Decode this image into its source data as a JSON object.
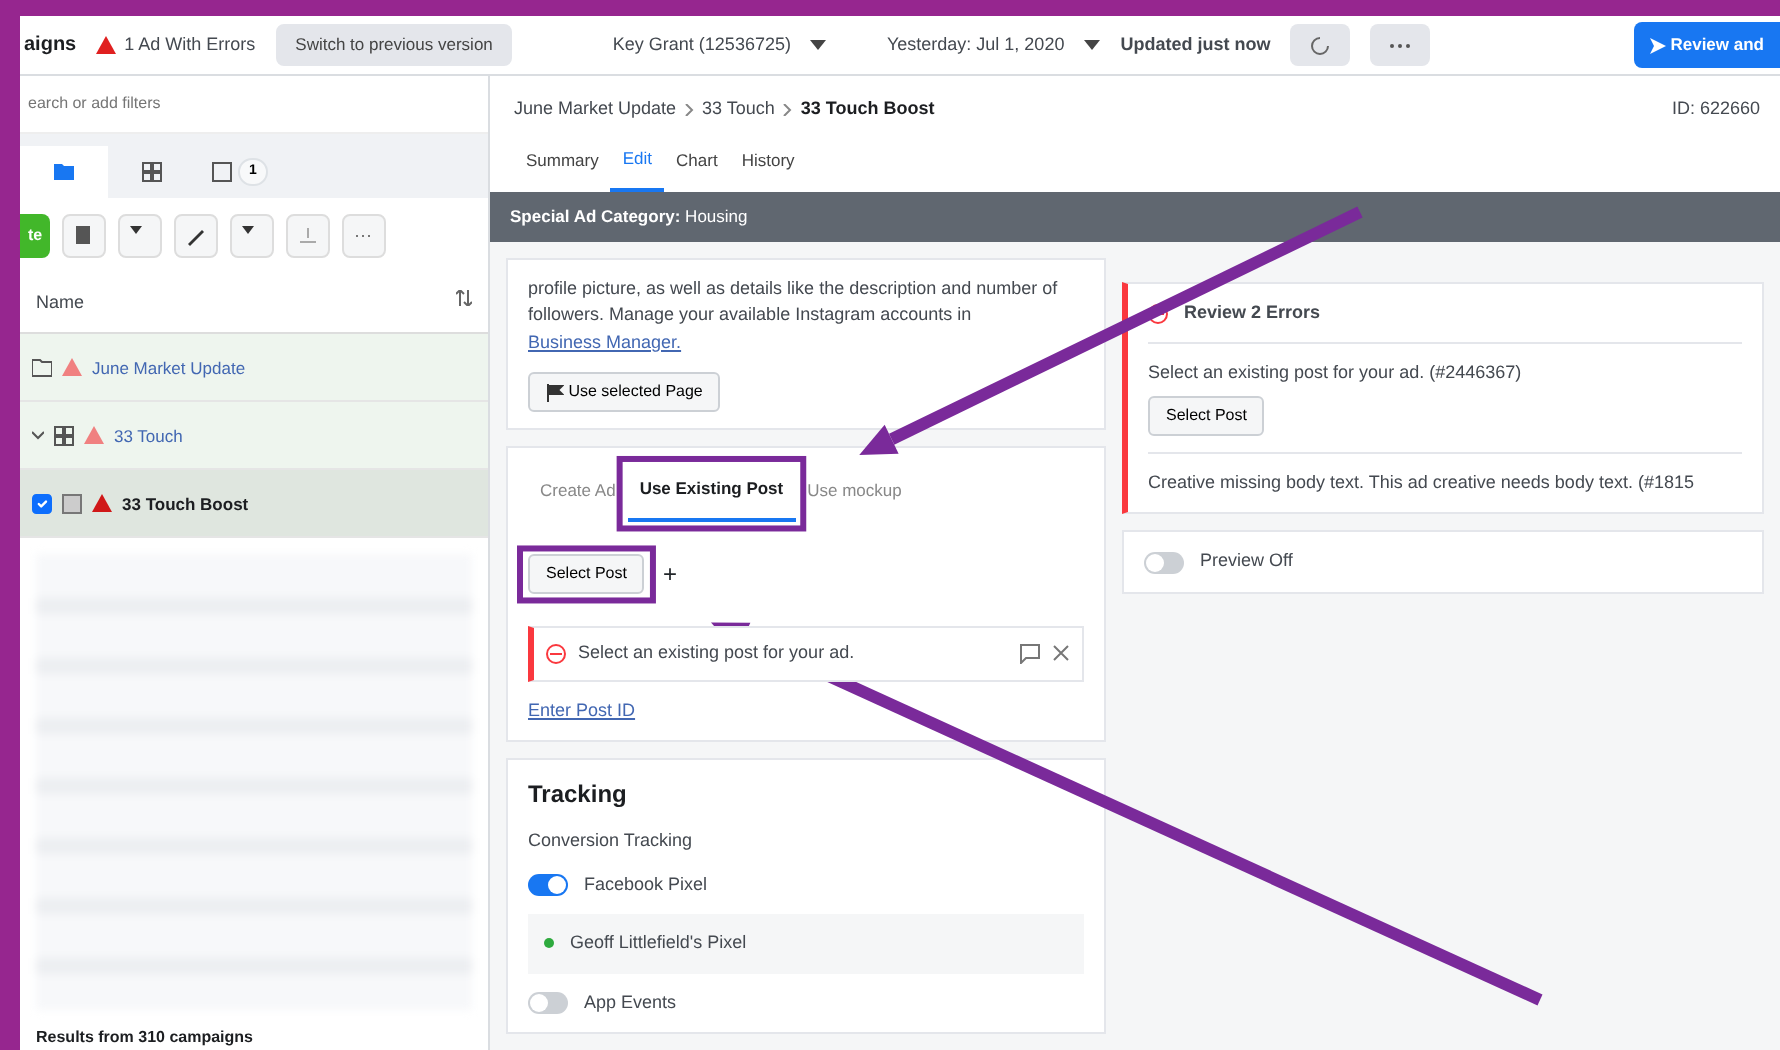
{
  "top_bar": {
    "title": "aigns",
    "errors": "1 Ad With Errors",
    "switch_button": "Switch to previous version",
    "account": "Key Grant (12536725)",
    "date": "Yesterday: Jul 1, 2020",
    "updated": "Updated just now",
    "review_button": "Review and"
  },
  "sidebar": {
    "search": {
      "placeholder": "earch or add filters"
    },
    "view_tabs": [
      {
        "kind": "folder",
        "selected": true
      },
      {
        "kind": "grid",
        "selected": false
      },
      {
        "kind": "ad",
        "selected": false,
        "count": "1"
      }
    ],
    "create_button": "te",
    "column": "Name",
    "tree": [
      {
        "label": "June Market Update",
        "kind": "campaign",
        "selected": false,
        "children": [
          {
            "label": "33 Touch",
            "kind": "adset",
            "selected": false,
            "expanded": true,
            "children": [
              {
                "label": "33 Touch Boost",
                "kind": "ad",
                "selected": true,
                "checked": true
              }
            ]
          }
        ]
      }
    ],
    "footer": "Results from 310 campaigns"
  },
  "header": {
    "breadcrumb": [
      "June Market Update",
      "33 Touch",
      "33 Touch Boost"
    ],
    "id": "ID: 622660",
    "tabs": [
      {
        "label": "Summary",
        "selected": false
      },
      {
        "label": "Edit",
        "selected": true
      },
      {
        "label": "Chart",
        "selected": false
      },
      {
        "label": "History",
        "selected": false
      }
    ]
  },
  "banner": "**Special Ad Category:** Housing",
  "identity": {
    "text": "profile picture, as well as details like the description and number of followers. Manage your available Instagram accounts in",
    "link": "Business Manager.",
    "page_button": "Use selected Page"
  },
  "creative": {
    "tabs": [
      {
        "label": "Create Ad",
        "selected": false
      },
      {
        "label": "Use Existing Post",
        "selected": true
      },
      {
        "label": "Use mockup",
        "selected": false
      }
    ],
    "select_button": "Select Post",
    "add": "+",
    "error": "Select an existing post for your ad.",
    "link": "Enter Post ID"
  },
  "tracking": {
    "title": "Tracking",
    "label": "Conversion Tracking",
    "pixel_toggle": {
      "label": "Facebook Pixel",
      "on": true
    },
    "pixel": {
      "name": "Geoff Littlefield's Pixel",
      "color": "#2eaa3e"
    },
    "app_toggle": {
      "label": "App Events",
      "on": false
    }
  },
  "review": {
    "title": "Review 2 Errors",
    "error_1": "Select an existing post for your ad. (#2446367)",
    "button": "Select Post",
    "error_2": "Creative missing body text. This ad creative needs body text. (#1815"
  },
  "preview": {
    "label": "Preview Off",
    "on": false
  }
}
